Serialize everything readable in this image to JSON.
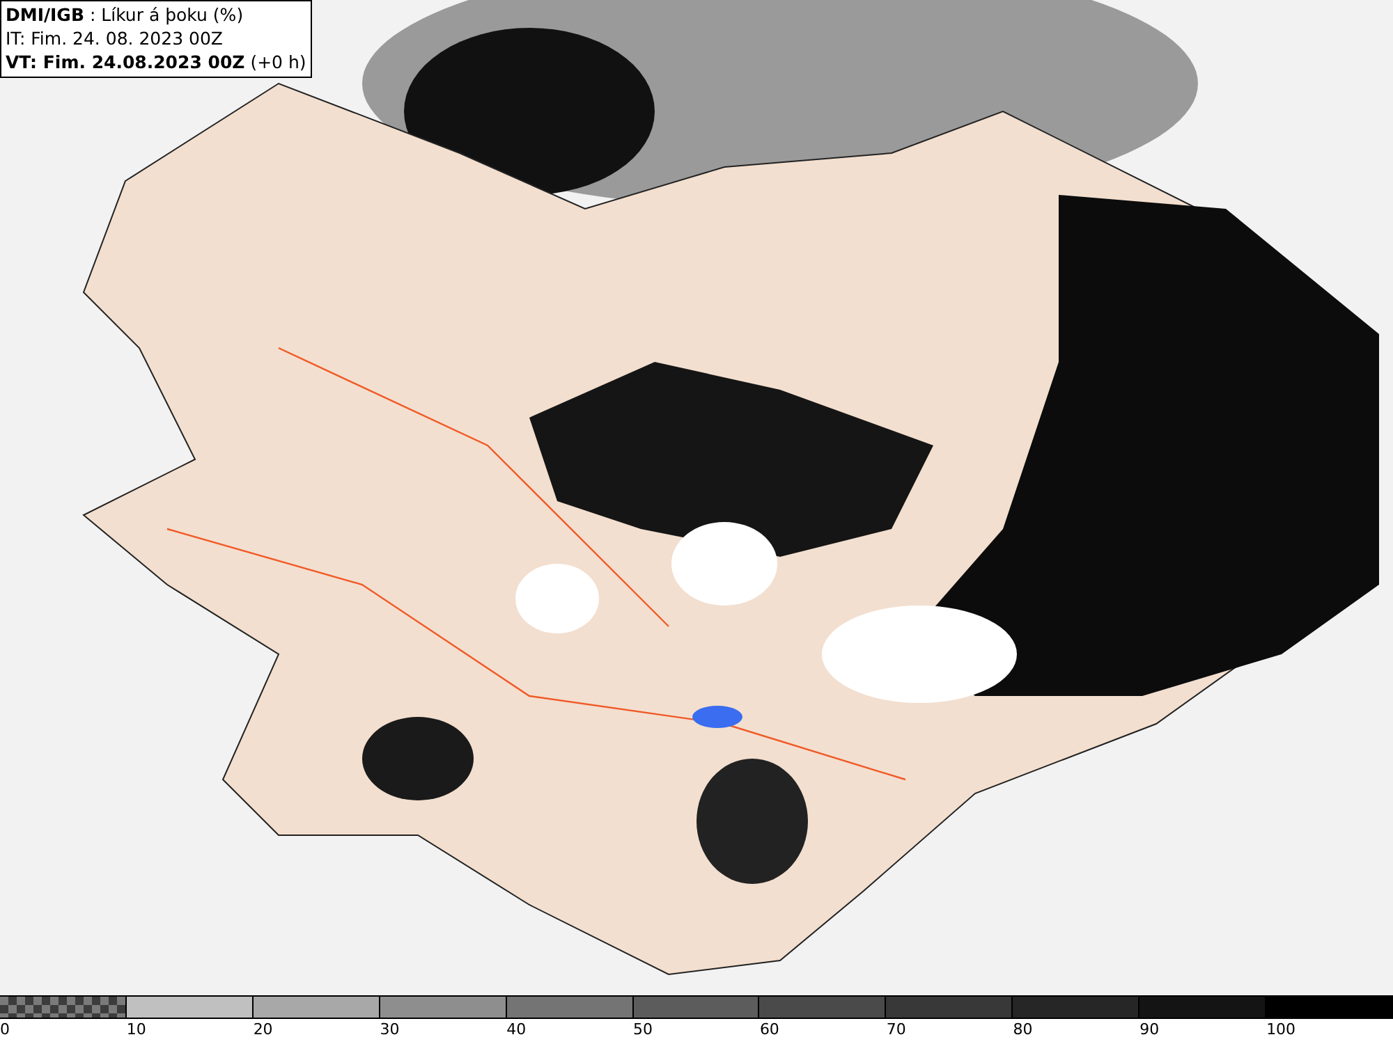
{
  "header": {
    "lines": [
      "**DMI/IGB** : Líkur á þoku (%)",
      "IT: Fim. 24. 08. 2023 00Z",
      "**VT: Fim. 24.08.2023 00Z** (+0 h)"
    ]
  },
  "legend": [
    {
      "label": "0",
      "kind": "checker"
    },
    {
      "label": "10",
      "kind": "solid",
      "color": "#c0c0c0"
    },
    {
      "label": "20",
      "kind": "solid",
      "color": "#a8a8a8"
    },
    {
      "label": "30",
      "kind": "solid",
      "color": "#8e8e8e"
    },
    {
      "label": "40",
      "kind": "solid",
      "color": "#747474"
    },
    {
      "label": "50",
      "kind": "solid",
      "color": "#5c5c5c"
    },
    {
      "label": "60",
      "kind": "solid",
      "color": "#4a4a4a"
    },
    {
      "label": "70",
      "kind": "solid",
      "color": "#383838"
    },
    {
      "label": "80",
      "kind": "solid",
      "color": "#262626"
    },
    {
      "label": "90",
      "kind": "solid",
      "color": "#141414"
    },
    {
      "label": "100",
      "kind": "solid",
      "color": "#000000"
    }
  ]
}
